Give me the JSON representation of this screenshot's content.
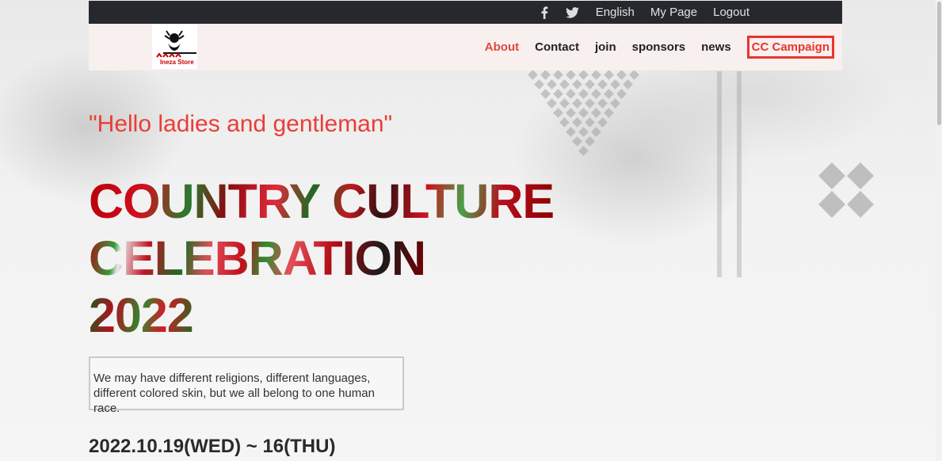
{
  "topbar": {
    "icons": [
      "facebook-icon",
      "twitter-icon"
    ],
    "links": [
      "English",
      "My Page",
      "Logout"
    ]
  },
  "nav": {
    "logo_text": "Ineza Store",
    "links": [
      "About",
      "Contact",
      "join",
      "sponsors",
      "news"
    ],
    "campaign": "CC Campaign"
  },
  "hero": {
    "greeting": "\"Hello ladies and gentleman\"",
    "title_line1": "COUNTRY CULTURE",
    "title_line2": "CELEBRATION",
    "title_line3": "2022",
    "quote_line1": "We may have different religions, different languages,",
    "quote_line2": "different colored skin, but we all belong to one human race.",
    "date": "2022.10.19(WED) ~ 16(THU)"
  },
  "colors": {
    "accent": "#e8352c",
    "topbar": "#26282d",
    "nav_bg": "#f8efef"
  }
}
